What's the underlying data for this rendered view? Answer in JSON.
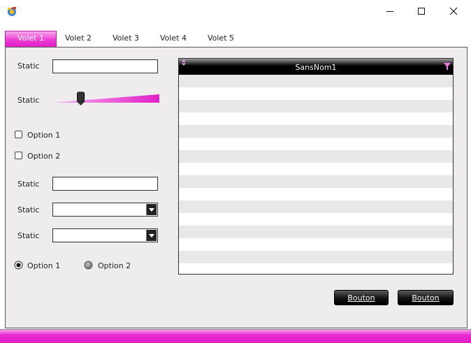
{
  "window": {
    "app_icon": "gear-app-icon",
    "minimize_icon": "minimize-icon",
    "maximize_icon": "maximize-icon",
    "close_icon": "close-icon"
  },
  "tabs": [
    {
      "label": "Volet 1",
      "active": true
    },
    {
      "label": "Volet 2",
      "active": false
    },
    {
      "label": "Volet 3",
      "active": false
    },
    {
      "label": "Volet 4",
      "active": false
    },
    {
      "label": "Volet 5",
      "active": false
    }
  ],
  "form": {
    "edit1": {
      "label": "Static",
      "value": ""
    },
    "slider": {
      "label": "Static",
      "value": 0.27
    },
    "check1": {
      "label": "Option 1",
      "checked": false
    },
    "check2": {
      "label": "Option 2",
      "checked": false
    },
    "edit2": {
      "label": "Static",
      "value": ""
    },
    "combo1": {
      "label": "Static",
      "value": ""
    },
    "combo2": {
      "label": "Static",
      "value": ""
    },
    "radio1": {
      "label": "Option 1",
      "selected": true
    },
    "radio2": {
      "label": "Option 2",
      "selected": false
    }
  },
  "table": {
    "column_header": "SansNom1",
    "rows": 16
  },
  "buttons": {
    "button1": "Bouton",
    "button2": "Bouton"
  },
  "colors": {
    "accent": "#e020c8",
    "header": "#000000",
    "panel": "#eeecec"
  }
}
